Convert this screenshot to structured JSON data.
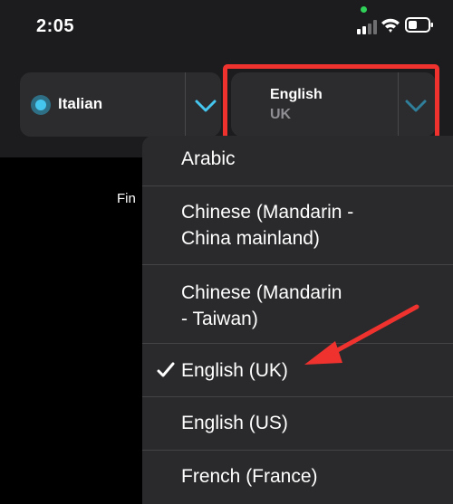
{
  "status_bar": {
    "time": "2:05"
  },
  "language_bar": {
    "source": {
      "label": "Italian",
      "icon": "radio-icon"
    },
    "target": {
      "label": "English",
      "sublabel": "UK",
      "icon": "chevron-down-icon"
    }
  },
  "background_text": "Fin",
  "dropdown": {
    "items": [
      {
        "line1": "Arabic",
        "line2": "",
        "selected": false
      },
      {
        "line1": "Chinese (Mandarin -",
        "line2": "China mainland)",
        "selected": false
      },
      {
        "line1": "Chinese (Mandarin",
        "line2": "- Taiwan)",
        "selected": false
      },
      {
        "line1": "English (UK)",
        "line2": "",
        "selected": true
      },
      {
        "line1": "English (US)",
        "line2": "",
        "selected": false
      },
      {
        "line1": "French (France)",
        "line2": "",
        "selected": false
      }
    ]
  },
  "colors": {
    "accent": "#45c6ef",
    "annotation": "#f0322f",
    "menu_bg": "#2a2a2c",
    "pill_bg": "#2c2c2e"
  }
}
